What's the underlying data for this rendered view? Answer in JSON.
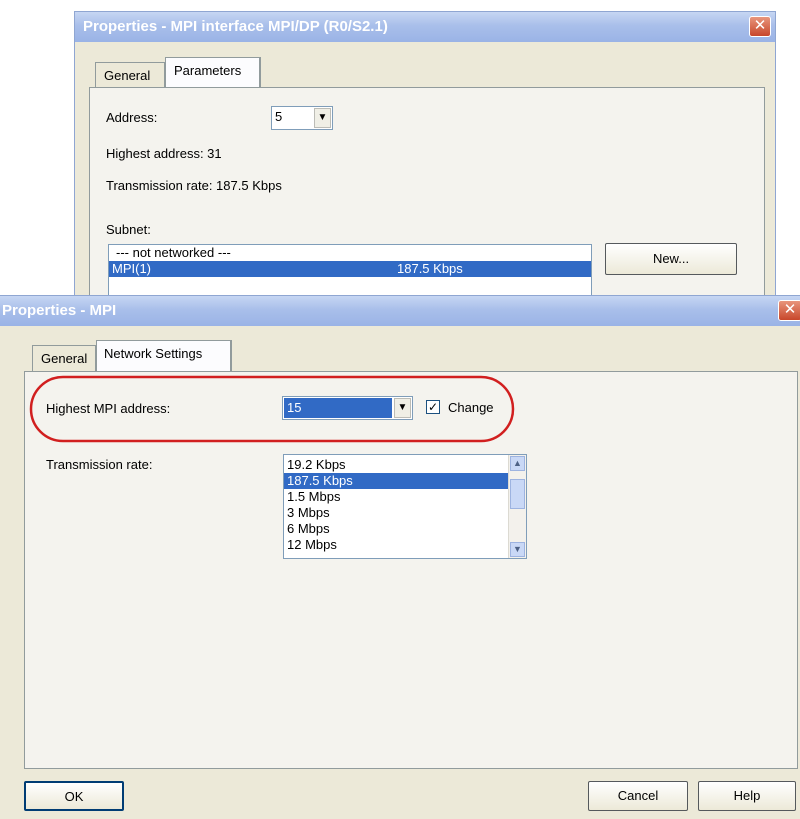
{
  "back_dialog": {
    "title": "Properties - MPI interface  MPI/DP (R0/S2.1)",
    "close_glyph": "✕",
    "tabs": [
      "General",
      "Parameters"
    ],
    "address_label": "Address:",
    "address_value": "5",
    "highest_address": "Highest address:  31",
    "transmission_rate": "Transmission rate: 187.5 Kbps",
    "subnet_label": "Subnet:",
    "subnet_items": [
      {
        "name": "--- not networked ---",
        "rate": ""
      },
      {
        "name": "MPI(1)",
        "rate": "187.5 Kbps"
      }
    ],
    "new_button": "New..."
  },
  "front_dialog": {
    "title": "Properties - MPI",
    "close_glyph": "✕",
    "tabs": [
      "General",
      "Network Settings"
    ],
    "highest_mpi_label": "Highest MPI address:",
    "highest_mpi_value": "15",
    "change_label": "Change",
    "change_checked": true,
    "transmission_label": "Transmission rate:",
    "rates": [
      "19.2 Kbps",
      "187.5 Kbps",
      "1.5 Mbps",
      "3 Mbps",
      "6 Mbps",
      "12 Mbps"
    ],
    "selected_rate": "187.5 Kbps",
    "ok_button": "OK",
    "cancel_button": "Cancel",
    "help_button": "Help"
  },
  "colors": {
    "highlight": "#316ac5",
    "annotation": "#d11f1f",
    "dialog_bg": "#ece9d8"
  }
}
